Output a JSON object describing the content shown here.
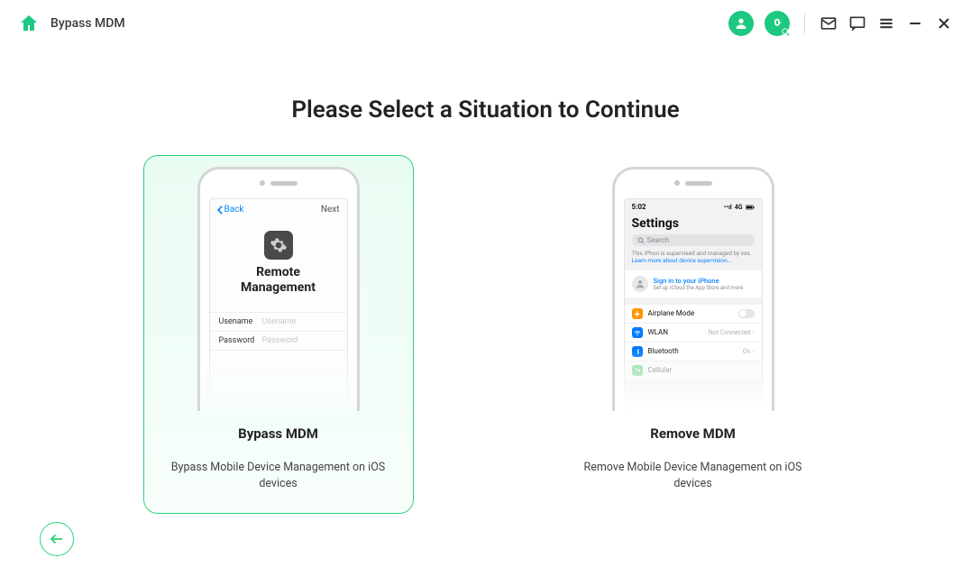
{
  "app_title": "Bypass MDM",
  "main_heading": "Please Select a Situation to Continue",
  "cards": {
    "bypass": {
      "title": "Bypass MDM",
      "desc": "Bypass Mobile Device Management on iOS devices",
      "phone": {
        "back_label": "Back",
        "next_label": "Next",
        "screen_title_line1": "Remote",
        "screen_title_line2": "Management",
        "field1_label": "Usename",
        "field1_placeholder": "Usename",
        "field2_label": "Password",
        "field2_placeholder": "Password"
      }
    },
    "remove": {
      "title": "Remove MDM",
      "desc": "Remove Mobile Device Management on iOS devices",
      "phone": {
        "time": "5:02",
        "network_text": "4G",
        "heading": "Settings",
        "search_placeholder": "Search",
        "info_text": "This iPhon is supervised and managed by xss.",
        "info_link": "Learn more about device supervision...",
        "signin_title": "Sign in to your iPhone",
        "signin_sub": "Set up iCloud the App Store and more",
        "rows": {
          "airplane": "Airplane Mode",
          "wlan": "WLAN",
          "wlan_status": "Not Connected",
          "bluetooth": "Bluetooth",
          "bluetooth_status": "On",
          "cellular": "Cellular"
        }
      }
    }
  }
}
